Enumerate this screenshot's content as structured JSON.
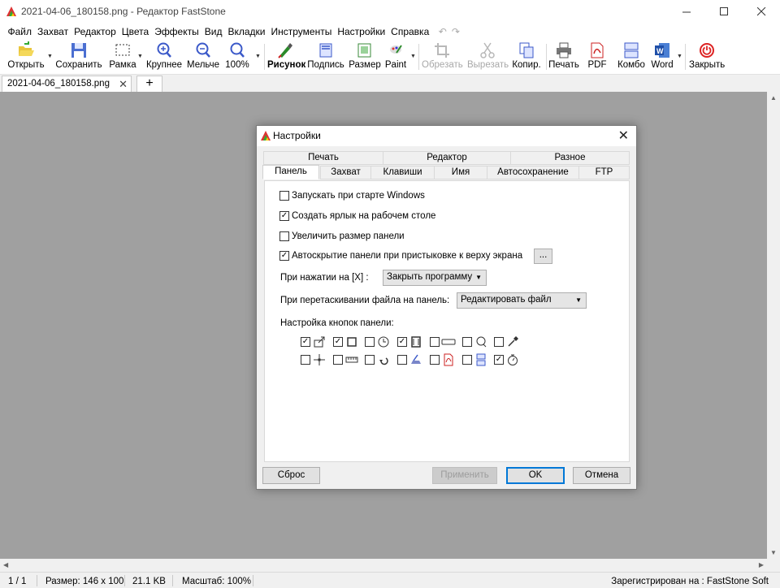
{
  "window": {
    "title": "2021-04-06_180158.png - Редактор FastStone"
  },
  "menu": [
    "Файл",
    "Захват",
    "Редактор",
    "Цвета",
    "Эффекты",
    "Вид",
    "Вкладки",
    "Инструменты",
    "Настройки",
    "Справка"
  ],
  "toolbar": {
    "open": "Открыть",
    "save": "Сохранить",
    "frame": "Рамка",
    "zoom_in": "Крупнее",
    "zoom_out": "Мельче",
    "zoom_100": "100%",
    "draw": "Рисунок",
    "caption": "Подпись",
    "resize": "Размер",
    "paint": "Paint",
    "crop": "Обрезать",
    "cut": "Вырезать",
    "copy": "Копир.",
    "print": "Печать",
    "pdf": "PDF",
    "combo": "Комбо",
    "word": "Word",
    "close": "Закрыть"
  },
  "tabs": {
    "doc": "2021-04-06_180158.png"
  },
  "status": {
    "page": "1 / 1",
    "size": "Размер: 146 x 100",
    "filesize": "21.1 KB",
    "zoom": "Масштаб: 100%",
    "registered": "Зарегистрирован на : FastStone Soft"
  },
  "dialog": {
    "title": "Настройки",
    "tabs_back": [
      "Печать",
      "Редактор",
      "Разное"
    ],
    "tabs_front": [
      "Панель",
      "Захват",
      "Клавиши",
      "Имя",
      "Автосохранение",
      "FTP"
    ],
    "opt_startup": "Запускать при старте Windows",
    "opt_shortcut": "Создать ярлык на рабочем столе",
    "opt_bigger": "Увеличить размер панели",
    "opt_autohide": "Автоскрытие панели при пристыковке к верху экрана",
    "more_btn": "...",
    "on_x_label": "При нажатии на [X] :",
    "on_x_value": "Закрыть программу",
    "drag_label": "При перетаскивании файла на панель:",
    "drag_value": "Редактировать файл",
    "buttons_label": "Настройка кнопок панели:",
    "checked_mark": "✓",
    "reset": "Сброс",
    "apply": "Применить",
    "ok": "OK",
    "cancel": "Отмена"
  }
}
